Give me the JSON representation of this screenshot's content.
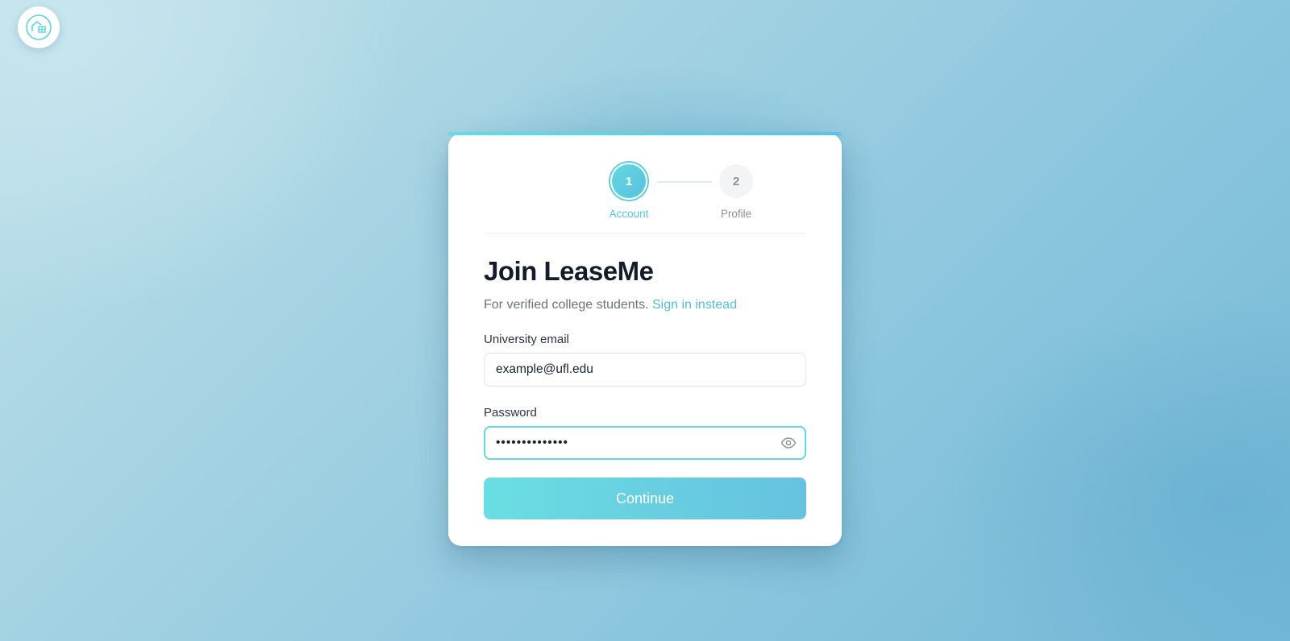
{
  "app": {
    "logo_icon": "house-logo-icon",
    "accent_color": "#5dcfe0"
  },
  "stepper": {
    "steps": [
      {
        "number": "1",
        "label": "Account",
        "state": "active"
      },
      {
        "number": "2",
        "label": "Profile",
        "state": "inactive"
      }
    ]
  },
  "form": {
    "title": "Join LeaseMe",
    "subtitle": "For verified college students.",
    "signin_link": "Sign in instead",
    "email": {
      "label": "University email",
      "value": "example@ufl.edu"
    },
    "password": {
      "label": "Password",
      "value": "••••••••••••••",
      "toggle_icon": "eye-icon"
    },
    "submit_label": "Continue"
  }
}
